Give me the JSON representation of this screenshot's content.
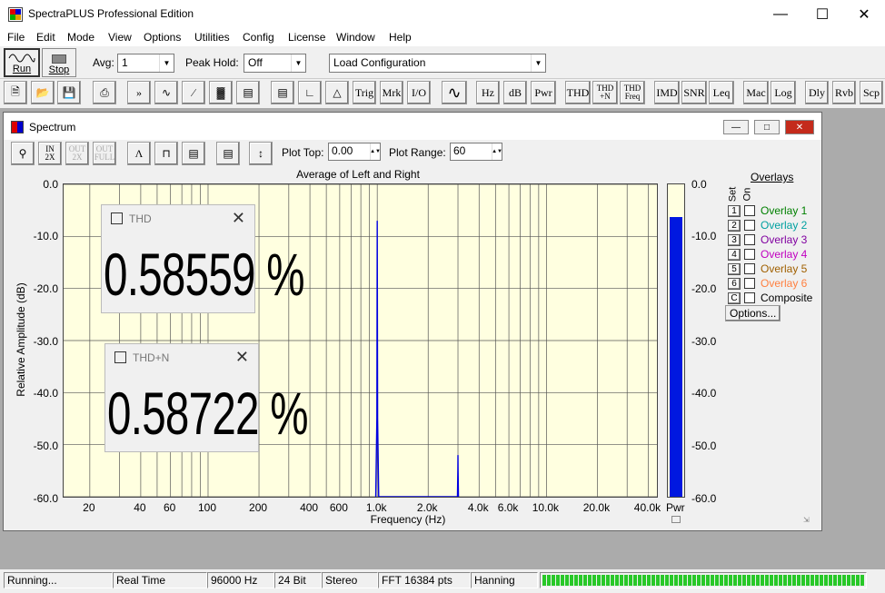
{
  "app": {
    "title": "SpectraPLUS Professional Edition"
  },
  "menu": [
    "File",
    "Edit",
    "Mode",
    "View",
    "Options",
    "Utilities",
    "Config",
    "License",
    "Window",
    "Help"
  ],
  "toolbar1": {
    "run_label": "Run",
    "stop_label": "Stop",
    "avg_label": "Avg:",
    "avg_value": "1",
    "peakhold_label": "Peak Hold:",
    "peakhold_value": "Off",
    "config_value": "Load Configuration"
  },
  "toolbar2": {
    "buttons": [
      "Trig",
      "Mrk",
      "I/O",
      "Hz",
      "dB",
      "Pwr",
      "THD",
      "THD\n+N",
      "THD\nFreq",
      "IMD",
      "SNR",
      "Leq",
      "Mac",
      "Log",
      "Dly",
      "Rvb",
      "Scp"
    ]
  },
  "spectrum": {
    "title": "Spectrum",
    "plot_top_label": "Plot Top:",
    "plot_top_value": "0.00",
    "plot_range_label": "Plot Range:",
    "plot_range_value": "60",
    "chart_title": "Average of Left and Right",
    "ylabel": "Relative Amplitude (dB)",
    "xlabel": "Frequency (Hz)",
    "yticks": [
      "0.0",
      "-10.0",
      "-20.0",
      "-30.0",
      "-40.0",
      "-50.0",
      "-60.0"
    ],
    "xticks": [
      "20",
      "40",
      "60",
      "100",
      "200",
      "400",
      "600",
      "1.0k",
      "2.0k",
      "4.0k",
      "6.0k",
      "10.0k",
      "20.0k",
      "40.0k"
    ],
    "meter_label": "Pwr",
    "meter_ticks": [
      "0.0",
      "-10.0",
      "-20.0",
      "-30.0",
      "-40.0",
      "-50.0",
      "-60.0"
    ],
    "meter_level_db": -6.3
  },
  "chart_data": {
    "type": "line",
    "title": "Average of Left and Right",
    "xlabel": "Frequency (Hz)",
    "ylabel": "Relative Amplitude (dB)",
    "xscale": "log",
    "xlim": [
      14,
      45000
    ],
    "ylim": [
      -60,
      0
    ],
    "series": [
      {
        "x": [
          980,
          995,
          1000,
          1005,
          1020,
          2980,
          2995,
          3000,
          3005,
          3020
        ],
        "y": [
          -60,
          -45,
          -7,
          -45,
          -60,
          -60,
          -55,
          -52,
          -55,
          -60
        ]
      }
    ],
    "grid": true
  },
  "thd_popup": {
    "title": "THD",
    "value": "0.58559 %"
  },
  "thdn_popup": {
    "title": "THD+N",
    "value": "0.58722 %"
  },
  "overlays": {
    "header": "Overlays",
    "set_label": "Set",
    "on_label": "On",
    "items": [
      {
        "num": "1",
        "name": "Overlay 1",
        "color": "#008000"
      },
      {
        "num": "2",
        "name": "Overlay 2",
        "color": "#00a0a0"
      },
      {
        "num": "3",
        "name": "Overlay 3",
        "color": "#8000a0"
      },
      {
        "num": "4",
        "name": "Overlay 4",
        "color": "#c000c0"
      },
      {
        "num": "5",
        "name": "Overlay 5",
        "color": "#a06000"
      },
      {
        "num": "6",
        "name": "Overlay 6",
        "color": "#ff8040"
      },
      {
        "num": "C",
        "name": "Composite",
        "color": "#000000"
      }
    ],
    "options_label": "Options..."
  },
  "status": {
    "state": "Running...",
    "mode": "Real Time",
    "rate": "96000 Hz",
    "bits": "24 Bit",
    "channels": "Stereo",
    "fft": "FFT 16384 pts",
    "window": "Hanning"
  }
}
